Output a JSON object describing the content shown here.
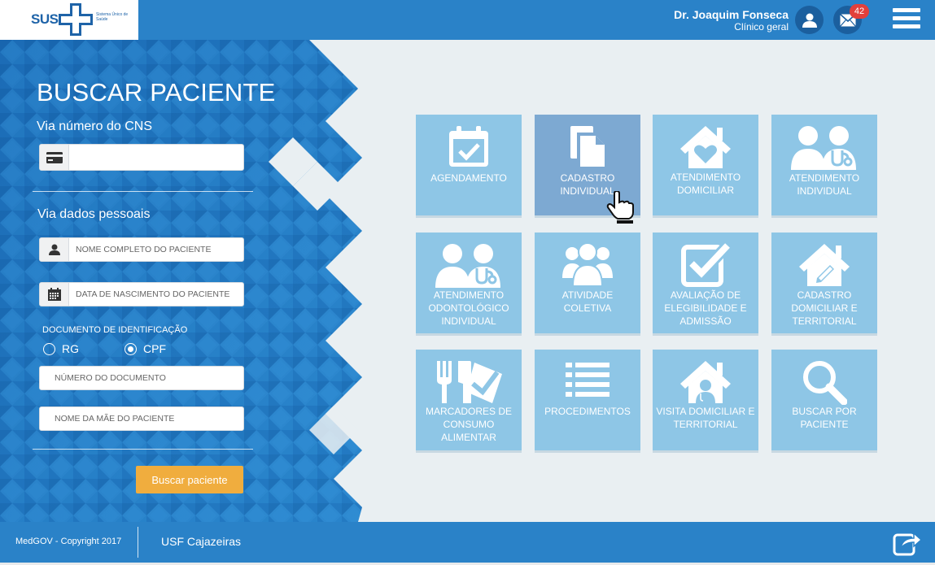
{
  "header": {
    "logo_text": "SUS",
    "logo_subtitle": "Sistema Único de Saúde",
    "user_name": "Dr. Joaquim Fonseca",
    "user_role": "Clínico geral",
    "mail_count": "42"
  },
  "search": {
    "title": "BUSCAR PACIENTE",
    "cns_label": "Via número do CNS",
    "cns_value": "",
    "personal_label": "Via dados pessoais",
    "name_placeholder": "NOME COMPLETO DO PACIENTE",
    "birth_placeholder": "DATA DE NASCIMENTO DO PACIENTE",
    "doc_label": "DOCUMENTO DE IDENTIFICAÇÃO",
    "radio_rg": "RG",
    "radio_cpf": "CPF",
    "selected_doc": "CPF",
    "doc_number_placeholder": "NÚMERO DO DOCUMENTO",
    "mother_placeholder": "NOME DA MÃE DO PACIENTE",
    "button_label": "Buscar paciente"
  },
  "tiles": [
    {
      "label": "AGENDAMENTO",
      "icon": "calendar-check-icon"
    },
    {
      "label": "CADASTRO INDIVIDUAL",
      "icon": "document-icon"
    },
    {
      "label": "ATENDIMENTO DOMICILIAR",
      "icon": "house-heart-icon"
    },
    {
      "label": "ATENDIMENTO INDIVIDUAL",
      "icon": "patient-doctor-icon"
    },
    {
      "label": "ATENDIMENTO ODONTOLÓGICO INDIVIDUAL",
      "icon": "patient-doctor-icon"
    },
    {
      "label": "ATIVIDADE COLETIVA",
      "icon": "group-icon"
    },
    {
      "label": "AVALIAÇÃO DE ELEGIBILIDADE E ADMISSÃO",
      "icon": "checkbox-icon"
    },
    {
      "label": "CADASTRO DOMICILIAR E TERRITORIAL",
      "icon": "house-pencil-icon"
    },
    {
      "label": "MARCADORES DE CONSUMO ALIMENTAR",
      "icon": "fork-check-icon"
    },
    {
      "label": "PROCEDIMENTOS",
      "icon": "list-icon"
    },
    {
      "label": "VISITA DOMICILIAR E TERRITORIAL",
      "icon": "house-person-icon"
    },
    {
      "label": "BUSCAR POR PACIENTE",
      "icon": "search-icon"
    }
  ],
  "footer": {
    "copyright": "MedGOV - Copyright 2017",
    "unit": "USF Cajazeiras"
  },
  "colors": {
    "primary": "#2a82c8",
    "tile": "#8ec6e6",
    "tile_active": "#7da9d2",
    "button": "#f0ad3e",
    "badge": "#e2403b"
  }
}
